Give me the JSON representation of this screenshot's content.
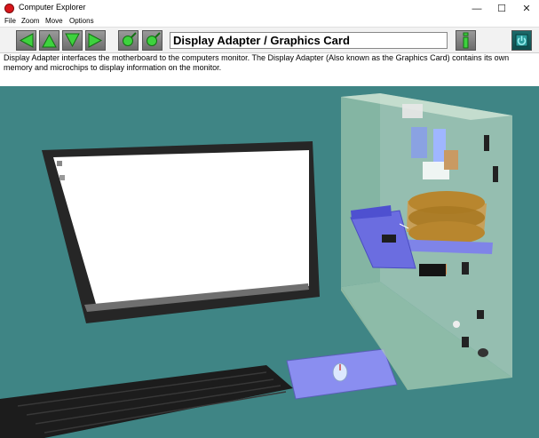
{
  "window": {
    "title": "Computer Explorer",
    "minimize_glyph": "—",
    "maximize_glyph": "☐",
    "close_glyph": "✕"
  },
  "menu": {
    "items": [
      "File",
      "Zoom",
      "Move",
      "Options"
    ]
  },
  "toolbar": {
    "buttons": [
      {
        "name": "back-arrow-icon"
      },
      {
        "name": "up-arrow-icon"
      },
      {
        "name": "down-arrow-icon"
      },
      {
        "name": "forward-arrow-icon"
      },
      {
        "name": "zoom-in-icon"
      },
      {
        "name": "zoom-out-icon"
      },
      {
        "name": "info-icon"
      },
      {
        "name": "exit-icon"
      }
    ],
    "component_title": "Display Adapter / Graphics Card"
  },
  "description": {
    "text": "Display Adapter interfaces the motherboard to the computers monitor. The Display Adapter (Also known as the Graphics Card) contains its own memory and microchips to display information on the monitor."
  },
  "scene": {
    "background_color": "#3f8585",
    "case_color": "#bcd9c4",
    "highlight_color": "#6b6de0",
    "monitor_frame_color": "#262626",
    "keyboard_color": "#1c1c1c",
    "mousepad_color": "#8a8ef0"
  }
}
